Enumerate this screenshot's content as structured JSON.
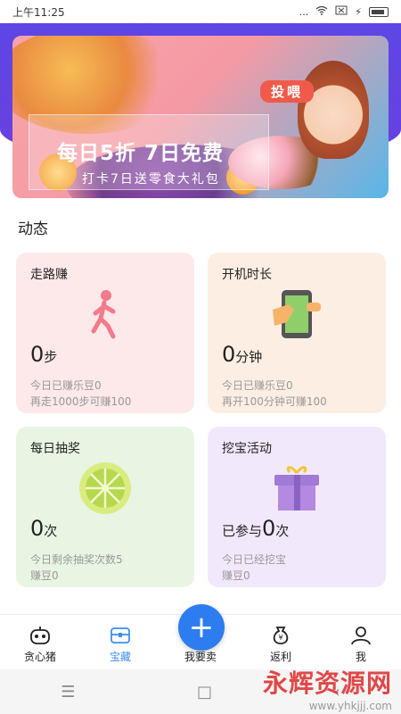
{
  "status_bar": {
    "time": "上午11:25",
    "signal": "...",
    "battery_label": ""
  },
  "banner": {
    "title": "每日5折 7日免费",
    "subtitle": "打卡7日送零食大礼包",
    "badge": "投喂"
  },
  "section": {
    "title": "动态"
  },
  "cards": [
    {
      "title": "走路赚",
      "value": "0",
      "unit": "步",
      "line1": "今日已赚乐豆0",
      "line2": "再走1000步可赚100",
      "icon": "walking-person-icon",
      "color": "#fde8ea"
    },
    {
      "title": "开机时长",
      "value": "0",
      "unit": "分钟",
      "line1": "今日已赚乐豆0",
      "line2": "再开100分钟可赚100",
      "icon": "phone-hand-icon",
      "color": "#fdeee3"
    },
    {
      "title": "每日抽奖",
      "value": "0",
      "unit": "次",
      "line1": "今日剩余抽奖次数5",
      "line2": "赚豆0",
      "icon": "lime-wheel-icon",
      "color": "#e9f5e3"
    },
    {
      "title": "挖宝活动",
      "prefix": "已参与",
      "value": "0",
      "unit": "次",
      "line1": "今日已经挖宝",
      "line2": "赚豆0",
      "icon": "gift-box-icon",
      "color": "#f1e9fb"
    }
  ],
  "tabs": [
    {
      "label": "贪心猪",
      "icon": "robot-icon",
      "active": false
    },
    {
      "label": "宝藏",
      "icon": "treasure-box-icon",
      "active": true
    },
    {
      "label": "我要卖",
      "icon": "plus-icon",
      "active": false
    },
    {
      "label": "返利",
      "icon": "money-bag-icon",
      "active": false
    },
    {
      "label": "我",
      "icon": "person-icon",
      "active": false
    }
  ],
  "watermark": {
    "text": "永辉资源网",
    "url": "www.yhkjjj.com"
  },
  "colors": {
    "accent": "#2d7df0",
    "active_tab": "#3c8ef0",
    "header": "#5b48e6"
  }
}
